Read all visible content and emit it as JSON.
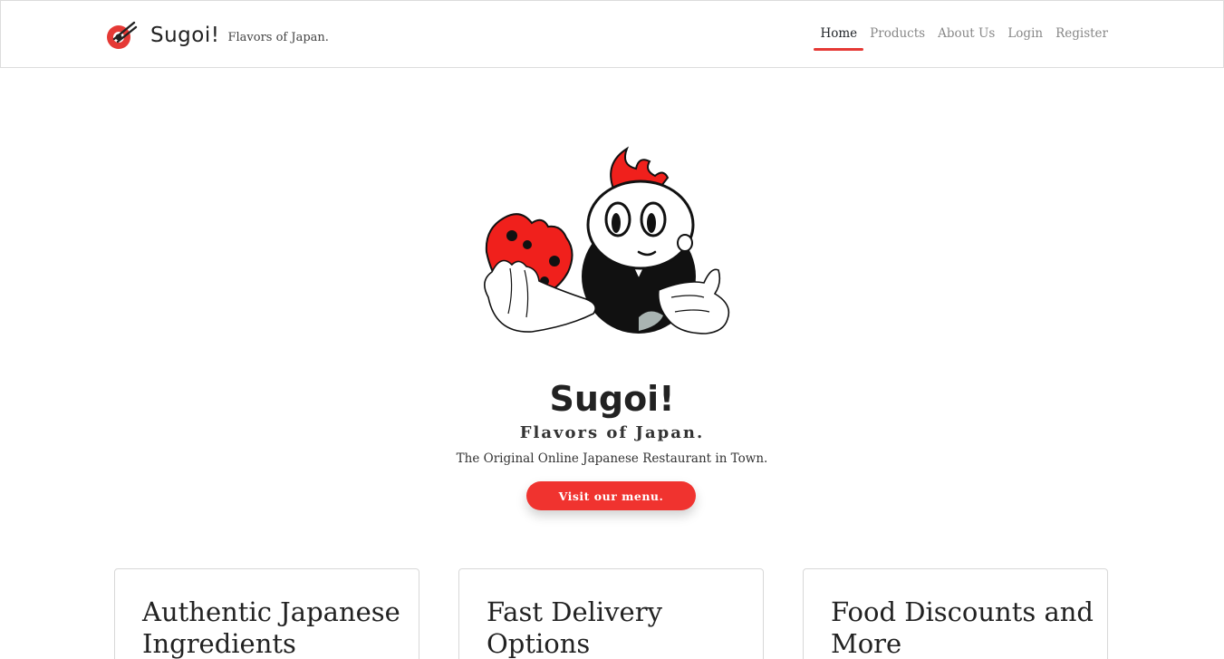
{
  "brand": {
    "name": "Sugoi!",
    "tagline": "Flavors of Japan."
  },
  "nav": {
    "items": [
      {
        "label": "Home",
        "active": true
      },
      {
        "label": "Products",
        "active": false
      },
      {
        "label": "About Us",
        "active": false
      },
      {
        "label": "Login",
        "active": false
      },
      {
        "label": "Register",
        "active": false
      }
    ]
  },
  "hero": {
    "title": "Sugoi!",
    "subtitle": "Flavors of Japan.",
    "description": "The Original Online Japanese Restaurant in Town.",
    "cta_label": "Visit our menu.",
    "illustration": "mascot-eating-cookie"
  },
  "features": [
    {
      "title": "Authentic Japanese Ingredients"
    },
    {
      "title": "Fast Delivery Options"
    },
    {
      "title": "Food Discounts and More"
    }
  ],
  "colors": {
    "accent": "#f0332f",
    "text": "#212529",
    "nav_muted": "#888888"
  }
}
